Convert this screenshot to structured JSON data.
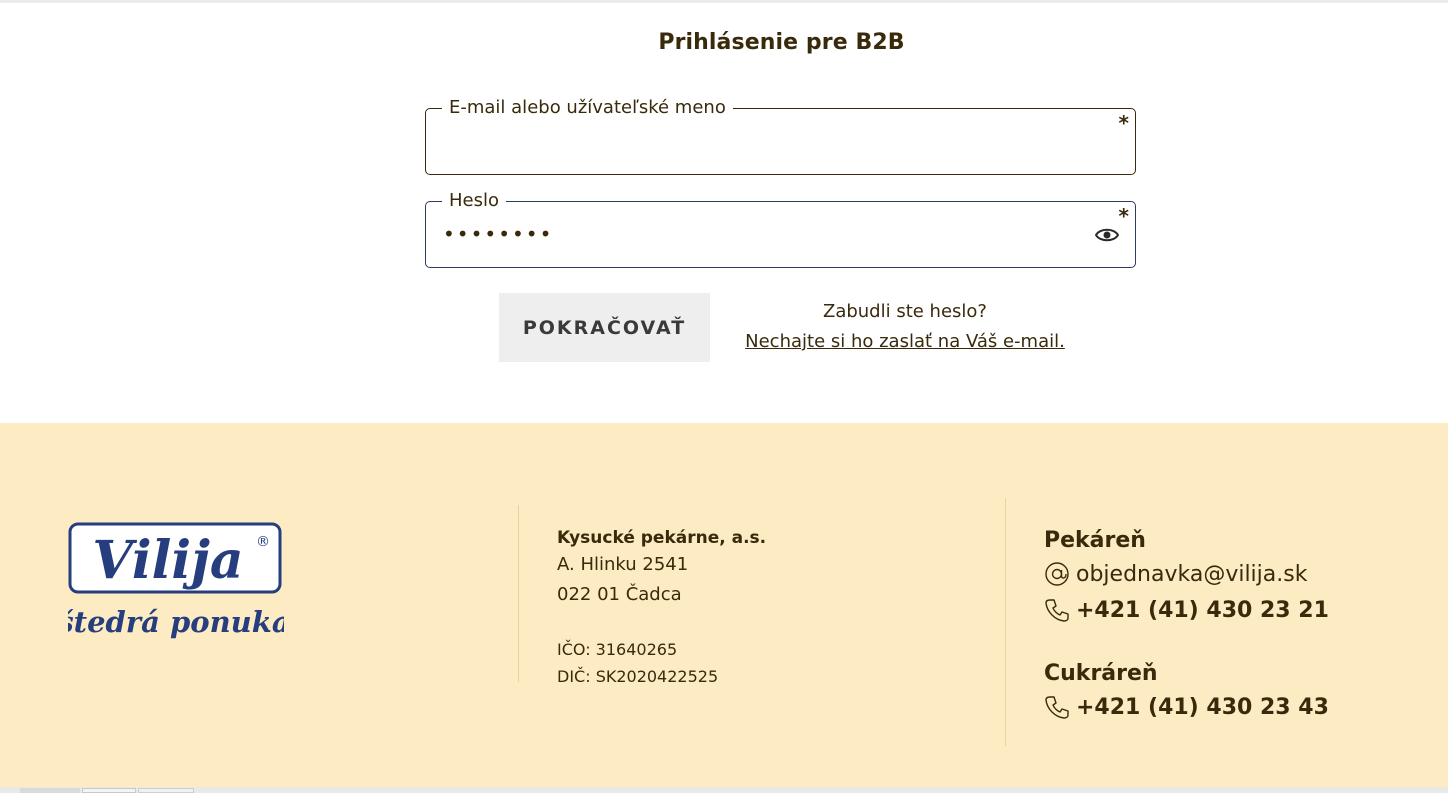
{
  "login": {
    "title": "Prihlásenie pre B2B",
    "email_field": {
      "label": "E-mail alebo užívateľské meno",
      "value": "",
      "required_mark": "*"
    },
    "password_field": {
      "label": "Heslo",
      "value": "••••••••",
      "required_mark": "*",
      "toggle_icon": "eye-icon"
    },
    "submit_label": "POKRAČOVAŤ",
    "forgot_question": "Zabudli ste heslo?",
    "forgot_link": "Nechajte si ho zaslať na Váš e-mail."
  },
  "footer": {
    "logo": {
      "brand": "Vilija",
      "tagline": "štedrá ponuka",
      "registered": "®"
    },
    "company": {
      "name": "Kysucké pekárne, a.s.",
      "street": "A. Hlinku 2541",
      "city": "022 01 Čadca",
      "ico": "IČO: 31640265",
      "dic": "DIČ: SK2020422525"
    },
    "bakery": {
      "heading": "Pekáreň",
      "email": "objednavka@vilija.sk",
      "phone": "+421 (41) 430 23 21"
    },
    "confectionery": {
      "heading": "Cukráreň",
      "phone": "+421 (41) 430 23 43"
    }
  },
  "colors": {
    "text": "#3a2a0c",
    "footer_bg": "#fdebc3",
    "logo_blue": "#263d7e",
    "button_bg": "#eeeeee"
  }
}
